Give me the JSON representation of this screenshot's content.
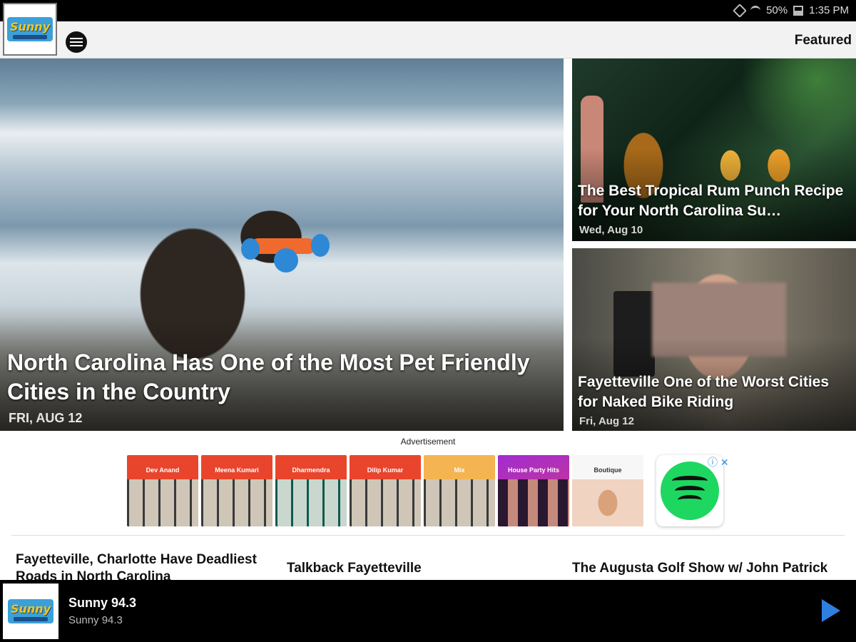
{
  "status": {
    "battery": "50%",
    "time": "1:35 PM"
  },
  "appbar": {
    "logo_text": "Sunny",
    "featured": "Featured"
  },
  "hero": {
    "title": "North Carolina Has One of the Most Pet Friendly Cities in the Country",
    "date": "FRI, AUG 12"
  },
  "cards": [
    {
      "title": "The Best Tropical Rum Punch Recipe for Your North Carolina Su…",
      "date": "Wed, Aug 10"
    },
    {
      "title": "Fayetteville One of the Worst Cities for Naked Bike Riding",
      "date": "Fri, Aug 12"
    }
  ],
  "ad": {
    "label": "Advertisement",
    "tiles": [
      "Dev Anand",
      "Meena Kumari",
      "Dharmendra",
      "Dilip Kumar",
      "Mix",
      "House Party Hits",
      "Boutique"
    ]
  },
  "list": [
    "Fayetteville, Charlotte Have Deadliest Roads in North Carolina",
    "Talkback Fayetteville",
    "The Augusta Golf Show w/ John Patrick"
  ],
  "player": {
    "station": "Sunny 94.3",
    "subtitle": "Sunny 94.3"
  },
  "colors": {
    "accent": "#2f7fe0",
    "ad_red": "#e8452c",
    "spotify": "#1ed760"
  }
}
